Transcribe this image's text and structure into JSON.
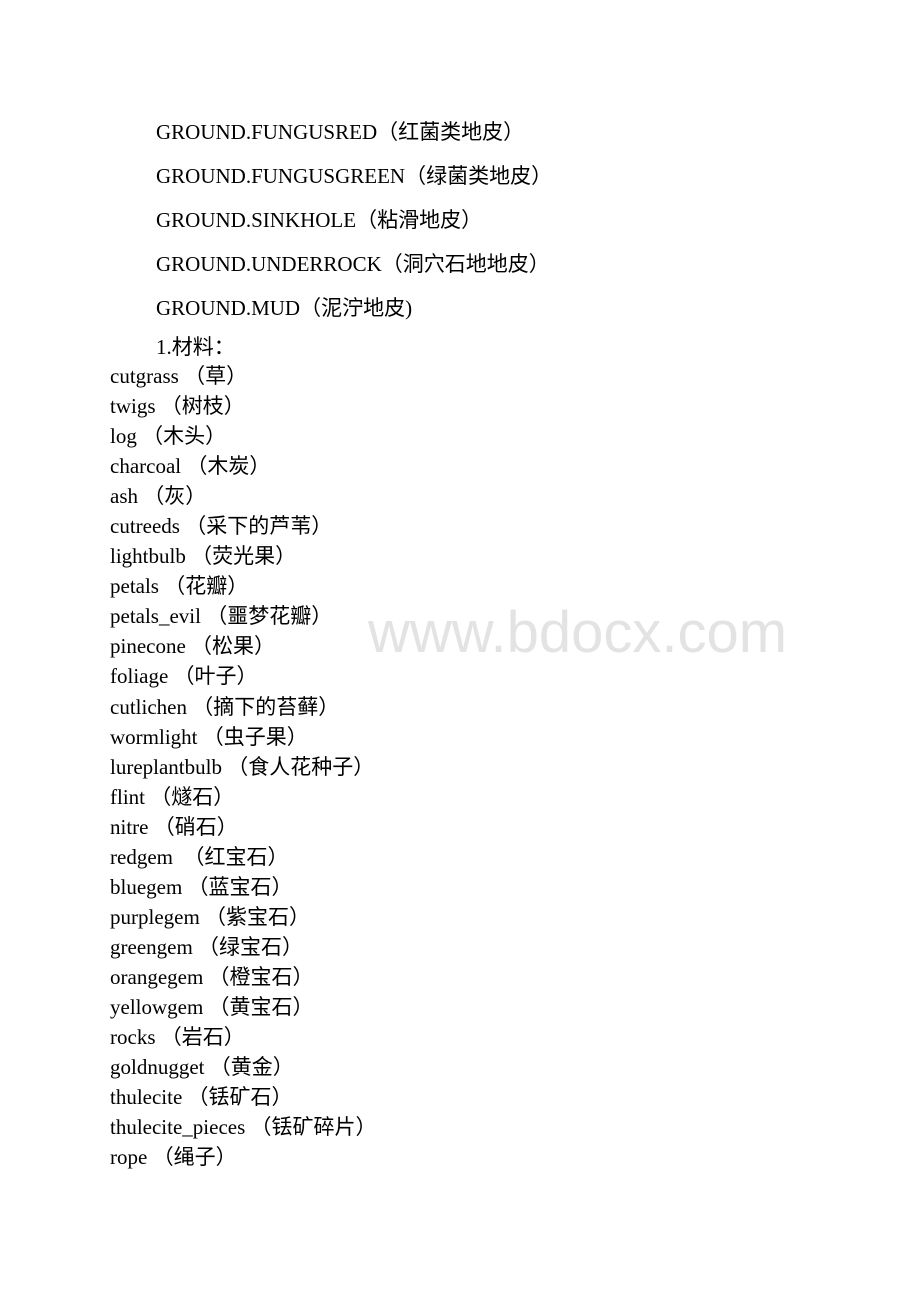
{
  "ground_types": [
    "GROUND.FUNGUSRED（红菌类地皮）",
    "GROUND.FUNGUSGREEN（绿菌类地皮）",
    "GROUND.SINKHOLE（粘滑地皮）",
    "GROUND.UNDERROCK（洞穴石地地皮）",
    "GROUND.MUD（泥泞地皮)"
  ],
  "section": {
    "heading": "1.材料："
  },
  "materials": [
    "cutgrass （草）",
    "twigs （树枝）",
    "log （木头）",
    "charcoal （木炭）",
    "ash （灰）",
    "cutreeds （采下的芦苇）",
    "lightbulb （荧光果）",
    "petals （花瓣）",
    "petals_evil （噩梦花瓣）",
    "pinecone （松果）",
    "foliage （叶子）",
    "cutlichen （摘下的苔藓）",
    "wormlight （虫子果）",
    "lureplantbulb （食人花种子）",
    "flint （燧石）",
    "nitre （硝石）",
    "redgem  （红宝石）",
    "bluegem （蓝宝石）",
    "purplegem （紫宝石）",
    "greengem （绿宝石）",
    "orangegem （橙宝石）",
    "yellowgem （黄宝石）",
    "rocks （岩石）",
    "goldnugget （黄金）",
    "thulecite （铥矿石）",
    "thulecite_pieces （铥矿碎片）",
    "rope （绳子）"
  ],
  "watermark": {
    "text": "www.bdocx.com"
  },
  "colors": {
    "text": "#000000",
    "watermark": "#e3e3e3",
    "background": "#ffffff"
  }
}
